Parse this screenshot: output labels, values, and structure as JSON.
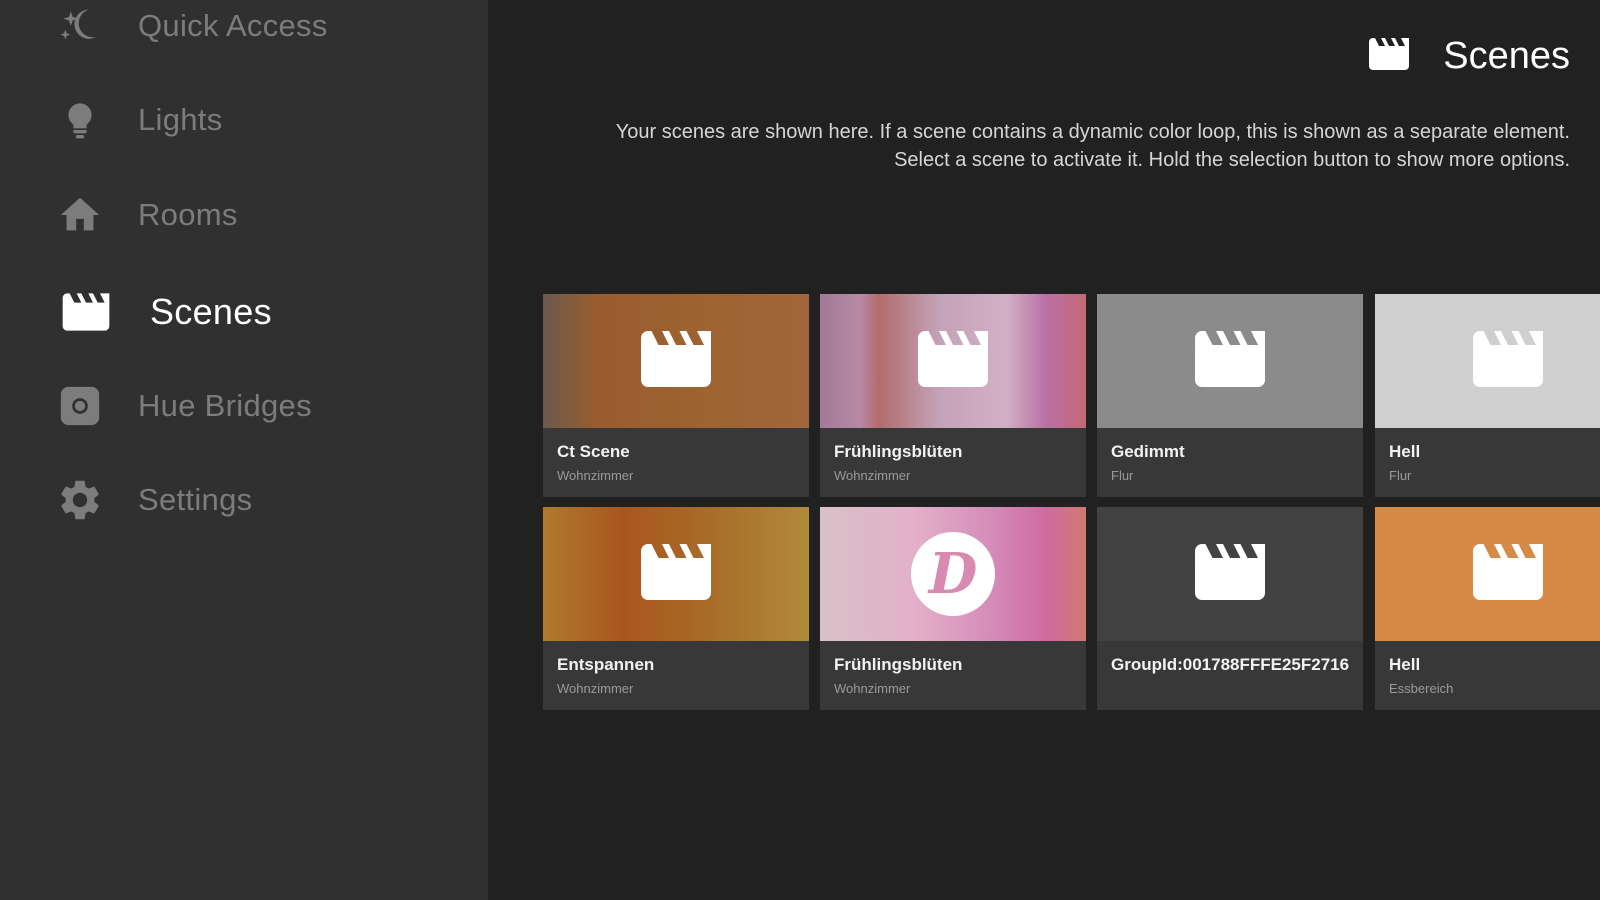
{
  "sidebar": {
    "items": [
      {
        "label": "Quick Access",
        "icon": "quick-access-icon"
      },
      {
        "label": "Lights",
        "icon": "bulb-icon"
      },
      {
        "label": "Rooms",
        "icon": "home-icon"
      },
      {
        "label": "Scenes",
        "icon": "clapperboard-icon",
        "active": true
      },
      {
        "label": "Hue Bridges",
        "icon": "bridge-icon"
      },
      {
        "label": "Settings",
        "icon": "gear-icon"
      }
    ]
  },
  "header": {
    "title": "Scenes",
    "description_line1": "Your scenes are shown here. If a scene contains a dynamic color loop, this is shown as a separate element.",
    "description_line2": "Select a scene to activate it. Hold the selection button to show more options."
  },
  "scenes": [
    {
      "name": "Ct Scene",
      "room": "Wohnzimmer",
      "icon": "clapperboard-icon"
    },
    {
      "name": "Frühlingsblüten",
      "room": "Wohnzimmer",
      "icon": "clapperboard-icon"
    },
    {
      "name": "Gedimmt",
      "room": "Flur",
      "icon": "clapperboard-icon"
    },
    {
      "name": "Hell",
      "room": "Flur",
      "icon": "clapperboard-icon"
    },
    {
      "name": "Entspannen",
      "room": "Wohnzimmer",
      "icon": "clapperboard-icon"
    },
    {
      "name": "Frühlingsblüten",
      "room": "Wohnzimmer",
      "icon": "dynamic-loop-icon",
      "icon_letter": "D"
    },
    {
      "name": "GroupId:001788FFFE25F2716",
      "room": "",
      "icon": "clapperboard-icon"
    },
    {
      "name": "Hell",
      "room": "Essbereich",
      "icon": "clapperboard-icon"
    }
  ],
  "colors": {
    "sidebar_bg": "#303030",
    "main_bg": "#212121",
    "card_bg": "#383838",
    "inactive_text": "#7c7c7c",
    "active_text": "#ffffff"
  }
}
